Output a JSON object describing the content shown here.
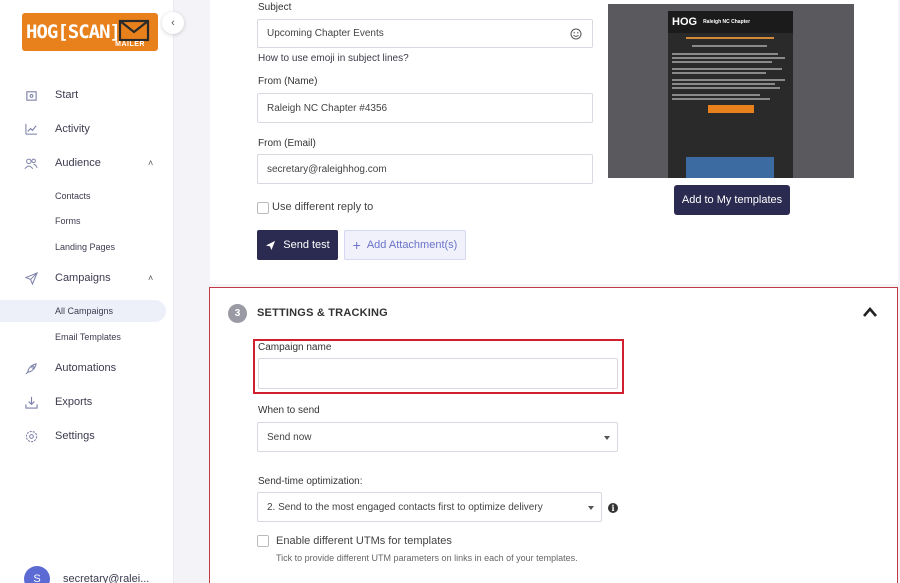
{
  "logo": {
    "text": "HOG[SCAN]",
    "sub": "MAILER"
  },
  "sidebar": {
    "items": [
      {
        "label": "Start"
      },
      {
        "label": "Activity"
      },
      {
        "label": "Audience"
      },
      {
        "label": "Campaigns"
      },
      {
        "label": "Automations"
      },
      {
        "label": "Exports"
      },
      {
        "label": "Settings"
      }
    ],
    "audience_sub": [
      {
        "label": "Contacts"
      },
      {
        "label": "Forms"
      },
      {
        "label": "Landing Pages"
      }
    ],
    "campaigns_sub": [
      {
        "label": "All Campaigns"
      },
      {
        "label": "Email Templates"
      }
    ],
    "user": {
      "initial": "S",
      "email": "secretary@ralei..."
    }
  },
  "compose": {
    "subject_label": "Subject",
    "subject_value": "Upcoming Chapter Events",
    "emoji_help": "How to use emoji in subject lines?",
    "from_name_label": "From (Name)",
    "from_name_value": "Raleigh NC Chapter #4356",
    "from_email_label": "From (Email)",
    "from_email_value": "secretary@raleighhog.com",
    "reply_to_label": "Use different reply to",
    "send_test_label": "Send test",
    "add_attachment_label": "Add Attachment(s)",
    "add_template_label": "Add to My templates",
    "preview": {
      "logo": "HOG",
      "title": "Raleigh NC Chapter"
    }
  },
  "settings": {
    "step_number": "3",
    "title": "SETTINGS & TRACKING",
    "campaign_name_label": "Campaign name",
    "campaign_name_value": "",
    "when_to_send_label": "When to send",
    "when_to_send_value": "Send now",
    "sto_label": "Send-time optimization:",
    "sto_value": "2. Send to the most engaged contacts first to optimize delivery",
    "utm_label": "Enable different UTMs for templates",
    "utm_help": "Tick to provide different UTM parameters on links in each of your templates."
  }
}
